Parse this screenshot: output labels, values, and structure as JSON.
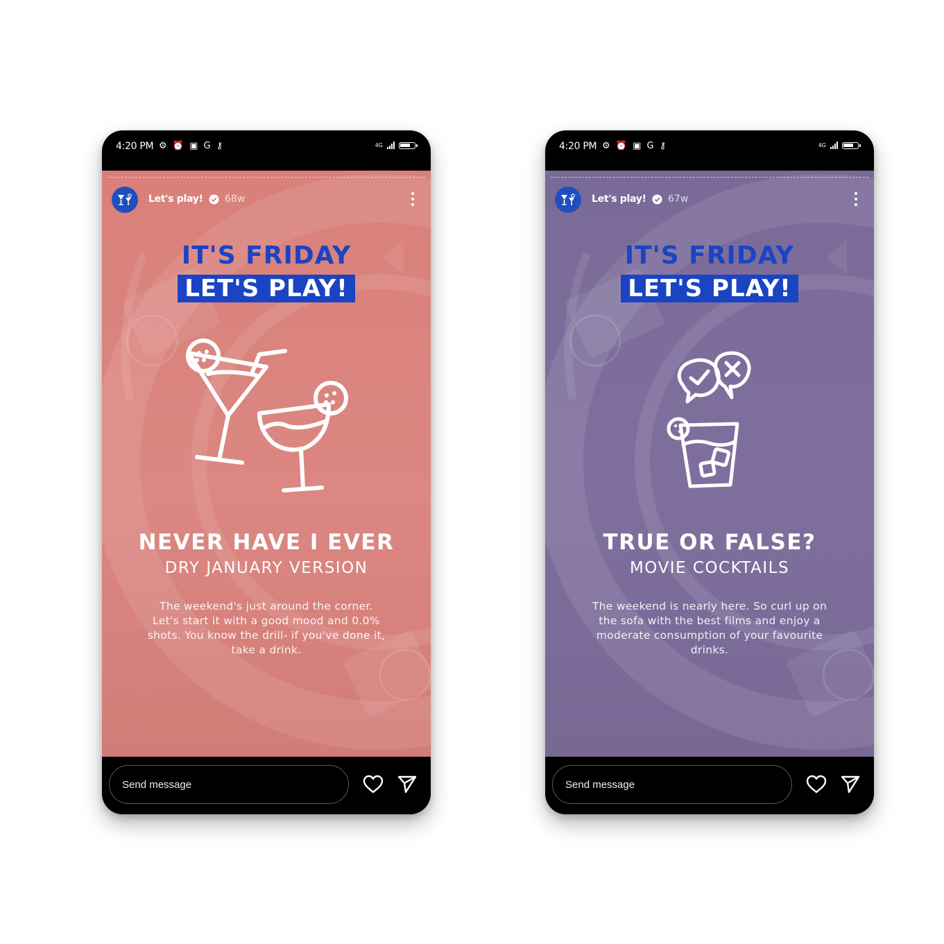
{
  "status_bar": {
    "time": "4:20 PM",
    "icons": "⚙ ⏰ ▣ G ⚷",
    "network": "4G"
  },
  "colors": {
    "accent_blue": "#1b44c4",
    "story1_bg": "#dc8782",
    "story2_bg": "#7f6f9e"
  },
  "stories": [
    {
      "account_name": "Let's play!",
      "post_age": "68w",
      "headline_1": "IT'S FRIDAY",
      "headline_2": "LET'S PLAY!",
      "title": "NEVER HAVE I EVER",
      "subtitle": "DRY JANUARY VERSION",
      "description": "The weekend's just around the corner. Let's start it with a good mood and 0.0% shots. You know the drill- if you've done it, take a drink.",
      "illustration": "cocktail-glasses-icon",
      "message_placeholder": "Send message"
    },
    {
      "account_name": "Let's play!",
      "post_age": "67w",
      "headline_1": "IT'S FRIDAY",
      "headline_2": "LET'S PLAY!",
      "title": "TRUE OR FALSE?",
      "subtitle": "MOVIE COCKTAILS",
      "description": "The weekend is nearly here. So curl up on the sofa with the best films and enjoy a moderate consumption of your favourite drinks.",
      "illustration": "true-false-drink-icon",
      "message_placeholder": "Send message"
    }
  ]
}
